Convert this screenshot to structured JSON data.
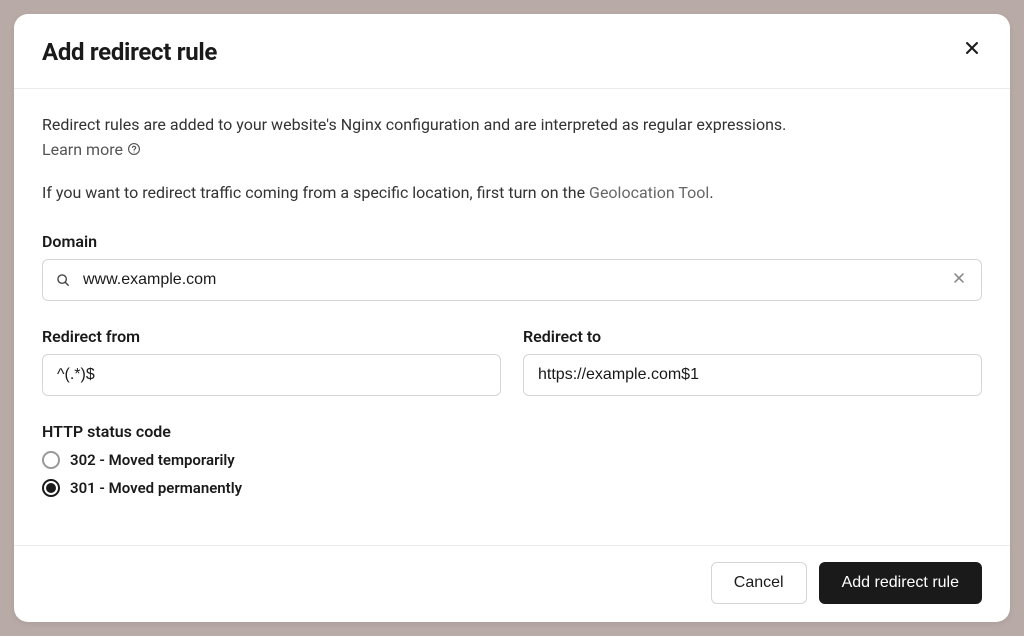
{
  "dialog": {
    "title": "Add redirect rule",
    "description": "Redirect rules are added to your website's Nginx configuration and are interpreted as regular expressions.",
    "learn_more_label": "Learn more",
    "geo_prefix": "If you want to redirect traffic coming from a specific location, first turn on the ",
    "geo_link_label": "Geolocation Tool",
    "geo_suffix": "."
  },
  "form": {
    "domain_label": "Domain",
    "domain_value": "www.example.com",
    "redirect_from_label": "Redirect from",
    "redirect_from_value": "^(.*)$",
    "redirect_to_label": "Redirect to",
    "redirect_to_value": "https://example.com$1",
    "status_code_label": "HTTP status code",
    "status_options": {
      "opt_302": "302 - Moved temporarily",
      "opt_301": "301 - Moved permanently"
    },
    "status_selected": "301"
  },
  "footer": {
    "cancel_label": "Cancel",
    "submit_label": "Add redirect rule"
  }
}
